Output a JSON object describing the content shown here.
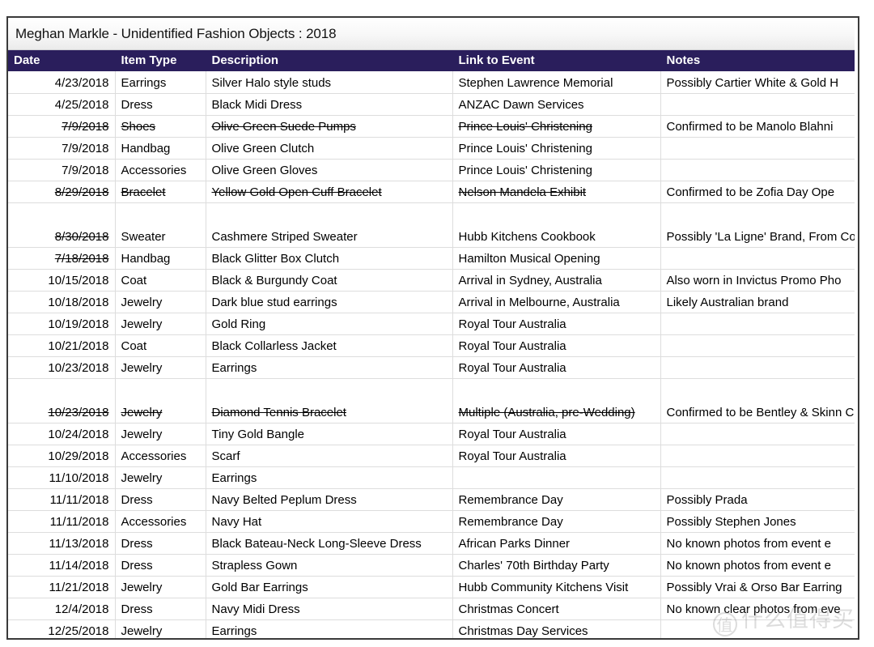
{
  "document": {
    "title": "Meghan Markle - Unidentified Fashion Objects : 2018"
  },
  "watermark": {
    "mark": "值",
    "text": "什么值得买"
  },
  "theme": {
    "header_background": "#2a1e5c",
    "header_text": "#ffffff",
    "link_color": "#2b57b7",
    "grid_line": "#dddddd",
    "frame_border": "#3a3a3a"
  },
  "table": {
    "columns": [
      {
        "key": "date",
        "label": "Date"
      },
      {
        "key": "type",
        "label": "Item Type"
      },
      {
        "key": "desc",
        "label": "Description"
      },
      {
        "key": "link",
        "label": "Link to Event"
      },
      {
        "key": "notes",
        "label": "Notes"
      }
    ],
    "rows": [
      {
        "date": "4/23/2018",
        "type": "Earrings",
        "desc": "Silver Halo style studs",
        "link": "Stephen Lawrence Memorial",
        "link_is_link": true,
        "notes": "Possibly Cartier White & Gold H",
        "strike": {
          "date": false,
          "type": false,
          "desc": false,
          "link": false
        }
      },
      {
        "date": "4/25/2018",
        "type": "Dress",
        "desc": "Black Midi Dress",
        "link": "ANZAC Dawn Services",
        "link_is_link": true,
        "notes": "",
        "strike": {
          "date": false,
          "type": false,
          "desc": false,
          "link": false
        }
      },
      {
        "date": "7/9/2018",
        "type": "Shoes",
        "desc": "Olive Green Suede Pumps",
        "link": "Prince Louis' Christening",
        "link_is_link": true,
        "notes": "Confirmed to be Manolo Blahni",
        "strike": {
          "date": true,
          "type": true,
          "desc": true,
          "link": true
        }
      },
      {
        "date": "7/9/2018",
        "type": "Handbag",
        "desc": "Olive Green Clutch",
        "link": "Prince Louis' Christening",
        "link_is_link": true,
        "notes": "",
        "strike": {
          "date": false,
          "type": false,
          "desc": false,
          "link": false
        }
      },
      {
        "date": "7/9/2018",
        "type": "Accessories",
        "desc": "Olive Green Gloves",
        "link": "Prince Louis' Christening",
        "link_is_link": true,
        "notes": "",
        "strike": {
          "date": false,
          "type": false,
          "desc": false,
          "link": false
        }
      },
      {
        "date": "8/29/2018",
        "type": "Bracelet",
        "desc": "Yellow Gold Open Cuff Bracelet",
        "link": "Nelson Mandela Exhibit",
        "link_is_link": true,
        "notes": "Confirmed to be Zofia Day Ope",
        "strike": {
          "date": true,
          "type": true,
          "desc": true,
          "link": true
        }
      },
      {
        "date": "8/30/2018",
        "type": "Sweater",
        "desc": "Cashmere Striped Sweater",
        "link": "Hubb Kitchens Cookbook",
        "link_is_link": true,
        "notes": "Possibly 'La Ligne' Brand, From Cookbook",
        "tall": true,
        "strike": {
          "date": true,
          "type": false,
          "desc": false,
          "link": false
        }
      },
      {
        "date": "7/18/2018",
        "type": "Handbag",
        "desc": "Black Glitter Box Clutch",
        "link": "Hamilton Musical Opening",
        "link_is_link": true,
        "notes": "",
        "strike": {
          "date": true,
          "type": false,
          "desc": false,
          "link": false
        }
      },
      {
        "date": "10/15/2018",
        "type": "Coat",
        "desc": "Black & Burgundy Coat",
        "link": "Arrival in Sydney, Australia",
        "link_is_link": true,
        "notes": "Also worn in Invictus Promo Pho",
        "strike": {
          "date": false,
          "type": false,
          "desc": false,
          "link": false
        }
      },
      {
        "date": "10/18/2018",
        "type": "Jewelry",
        "desc": "Dark blue stud earrings",
        "link": "Arrival in Melbourne, Australia",
        "link_is_link": true,
        "notes": "Likely Australian brand",
        "strike": {
          "date": false,
          "type": false,
          "desc": false,
          "link": false
        }
      },
      {
        "date": "10/19/2018",
        "type": "Jewelry",
        "desc": "Gold Ring",
        "link": "Royal Tour Australia",
        "link_is_link": false,
        "notes": "",
        "strike": {
          "date": false,
          "type": false,
          "desc": false,
          "link": false
        }
      },
      {
        "date": "10/21/2018",
        "type": "Coat",
        "desc": "Black Collarless Jacket",
        "link": "Royal Tour Australia",
        "link_is_link": false,
        "notes": "",
        "strike": {
          "date": false,
          "type": false,
          "desc": false,
          "link": false
        }
      },
      {
        "date": "10/23/2018",
        "type": "Jewelry",
        "desc": "Earrings",
        "link": "Royal Tour Australia",
        "link_is_link": false,
        "notes": "",
        "strike": {
          "date": false,
          "type": false,
          "desc": false,
          "link": false
        }
      },
      {
        "date": "10/23/2018",
        "type": "Jewelry",
        "desc": "Diamond Tennis Bracelet",
        "link": "Multiple (Australia, pre-Wedding)",
        "link_is_link": true,
        "notes": "Confirmed to be Bentley & Skinn Charles",
        "tall": true,
        "strike": {
          "date": true,
          "type": true,
          "desc": true,
          "link": true
        }
      },
      {
        "date": "10/24/2018",
        "type": "Jewelry",
        "desc": "Tiny Gold Bangle",
        "link": "Royal Tour Australia",
        "link_is_link": false,
        "notes": "",
        "strike": {
          "date": false,
          "type": false,
          "desc": false,
          "link": false
        }
      },
      {
        "date": "10/29/2018",
        "type": "Accessories",
        "desc": "Scarf",
        "link": "Royal Tour Australia",
        "link_is_link": false,
        "notes": "",
        "strike": {
          "date": false,
          "type": false,
          "desc": false,
          "link": false
        }
      },
      {
        "date": "11/10/2018",
        "type": "Jewelry",
        "desc": "Earrings",
        "link": "",
        "link_is_link": false,
        "notes": "",
        "strike": {
          "date": false,
          "type": false,
          "desc": false,
          "link": false
        }
      },
      {
        "date": "11/11/2018",
        "type": "Dress",
        "desc": "Navy Belted Peplum Dress",
        "link": "Remembrance Day",
        "link_is_link": true,
        "notes": "Possibly Prada",
        "strike": {
          "date": false,
          "type": false,
          "desc": false,
          "link": false
        }
      },
      {
        "date": "11/11/2018",
        "type": "Accessories",
        "desc": "Navy Hat",
        "link": "Remembrance Day",
        "link_is_link": true,
        "notes": "Possibly Stephen Jones",
        "strike": {
          "date": false,
          "type": false,
          "desc": false,
          "link": false
        }
      },
      {
        "date": "11/13/2018",
        "type": "Dress",
        "desc": "Black Bateau-Neck Long-Sleeve Dress",
        "link": "African Parks Dinner",
        "link_is_link": true,
        "notes": "No known photos from event e",
        "strike": {
          "date": false,
          "type": false,
          "desc": false,
          "link": false
        }
      },
      {
        "date": "11/14/2018",
        "type": "Dress",
        "desc": "Strapless Gown",
        "link": "Charles' 70th Birthday Party",
        "link_is_link": true,
        "notes": "No known photos from event e",
        "strike": {
          "date": false,
          "type": false,
          "desc": false,
          "link": false
        }
      },
      {
        "date": "11/21/2018",
        "type": "Jewelry",
        "desc": "Gold Bar Earrings",
        "link": "Hubb Community Kitchens Visit",
        "link_is_link": true,
        "notes": "Possibly Vrai & Orso Bar Earring",
        "strike": {
          "date": false,
          "type": false,
          "desc": false,
          "link": false
        }
      },
      {
        "date": "12/4/2018",
        "type": "Dress",
        "desc": "Navy Midi Dress",
        "link": "Christmas Concert",
        "link_is_link": true,
        "notes": "No known clear photos from eve",
        "strike": {
          "date": false,
          "type": false,
          "desc": false,
          "link": false
        }
      },
      {
        "date": "12/25/2018",
        "type": "Jewelry",
        "desc": "Earrings",
        "link": "Christmas Day Services",
        "link_is_link": true,
        "notes": "",
        "strike": {
          "date": false,
          "type": false,
          "desc": false,
          "link": false
        }
      }
    ]
  }
}
